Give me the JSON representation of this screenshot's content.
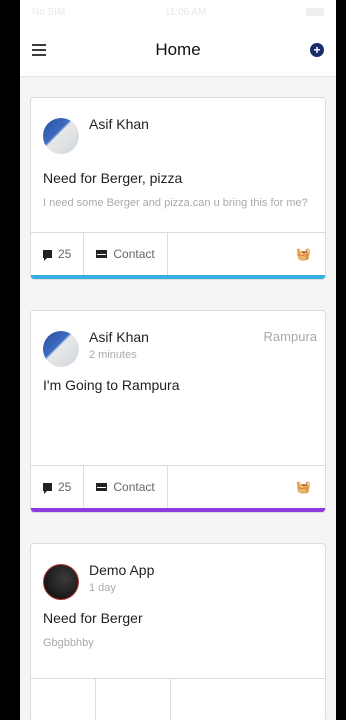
{
  "status": {
    "carrier": "No SIM",
    "time": "11:06 AM"
  },
  "nav": {
    "title": "Home"
  },
  "colors": {
    "card1_accent": "#38aee0",
    "card2_accent": "#8b3bdc"
  },
  "posts": [
    {
      "name": "Asif Khan",
      "time": "",
      "location": "",
      "title": "Need for Berger, pizza",
      "description": "I need some Berger and pizza.can u bring this for me?",
      "comments": "25",
      "contact": "Contact"
    },
    {
      "name": "Asif Khan",
      "time": "2 minutes",
      "location": "Rampura",
      "title": "I'm Going to Rampura",
      "description": "",
      "comments": "25",
      "contact": "Contact"
    },
    {
      "name": "Demo App",
      "time": "1 day",
      "location": "",
      "title": "Need for Berger",
      "description": "Gbgbbhby",
      "comments": "",
      "contact": ""
    }
  ]
}
